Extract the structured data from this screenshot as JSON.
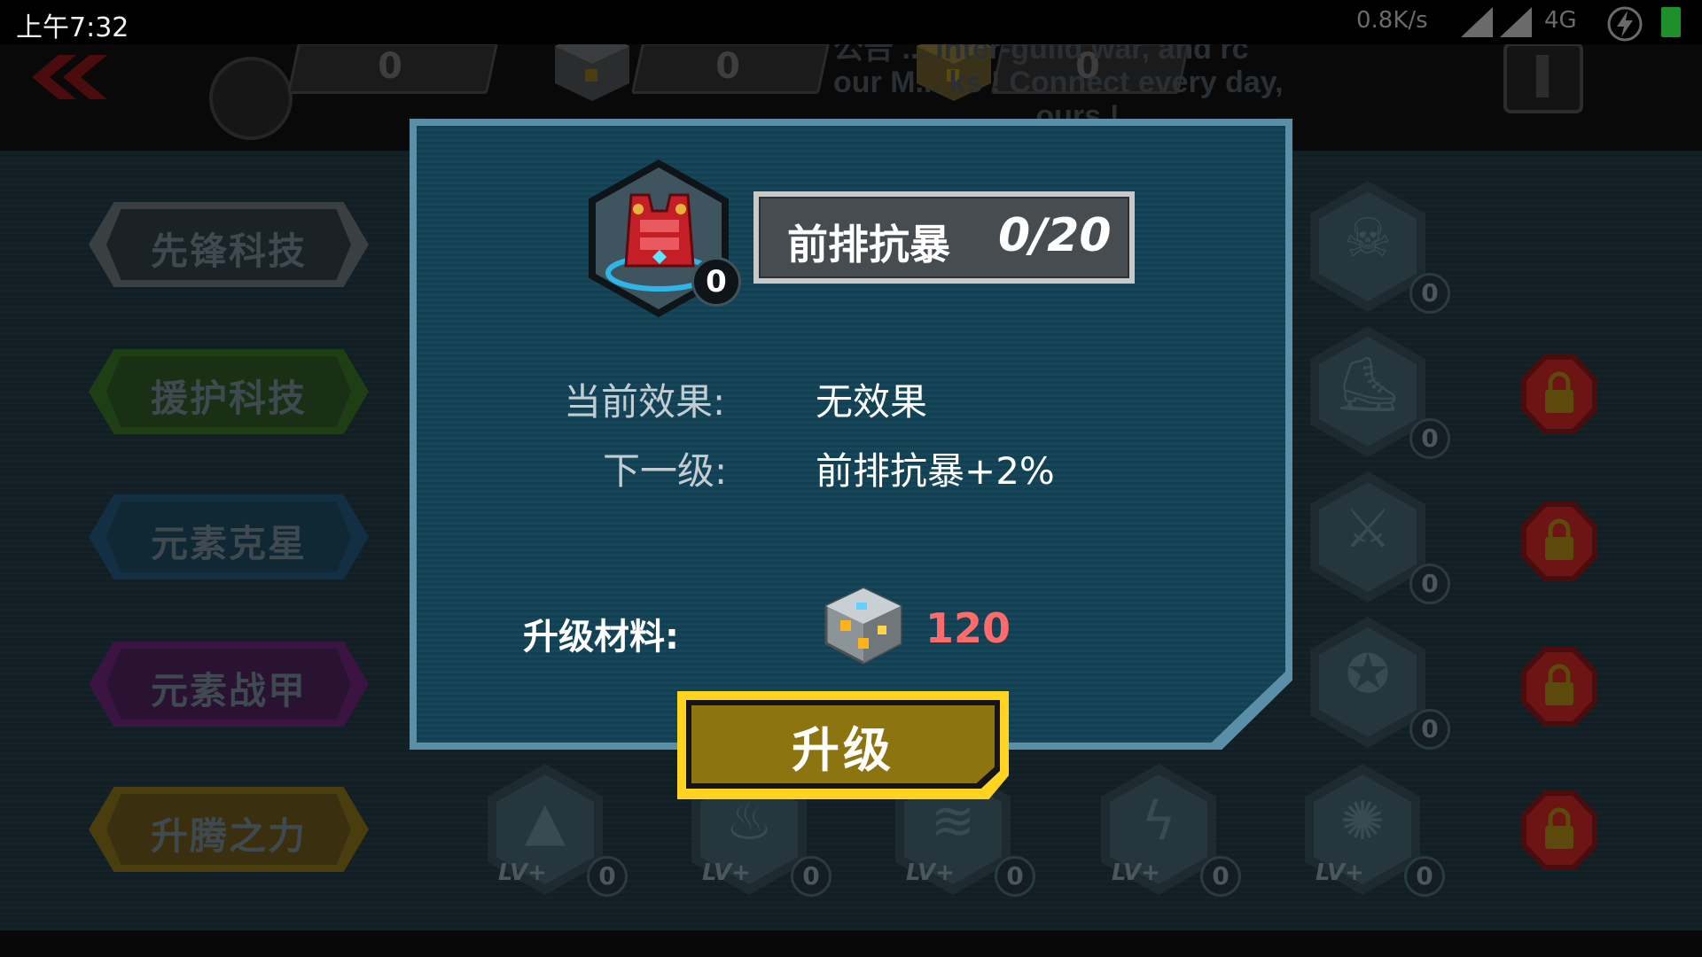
{
  "status_bar": {
    "time": "上午7:32",
    "net_speed": "0.8K/s",
    "network_type": "4G"
  },
  "resources": [
    {
      "icon": "medal-icon",
      "value": "0"
    },
    {
      "icon": "silver-cube-icon",
      "value": "0"
    },
    {
      "icon": "gold-cube-icon",
      "value": "0"
    }
  ],
  "ticker": {
    "line1": "公告 ... inter-guild war, and rc",
    "line2": "our M...     ks ! Connect every day,",
    "line3": "...ours !"
  },
  "categories": [
    {
      "label": "先锋科技",
      "color": "#6a6f72"
    },
    {
      "label": "援护科技",
      "color": "#2f7a1c"
    },
    {
      "label": "元素克星",
      "color": "#1d5f8c"
    },
    {
      "label": "元素战甲",
      "color": "#7a1d86"
    },
    {
      "label": "升腾之力",
      "color": "#a8861a"
    }
  ],
  "skill_slots_right": [
    {
      "icon": "skull-icon",
      "count": "0"
    },
    {
      "icon": "boot-icon",
      "count": "0"
    },
    {
      "icon": "blade-icon",
      "count": "0"
    },
    {
      "icon": "orbit-icon",
      "count": "0"
    }
  ],
  "bottom_slots": [
    {
      "icon": "mountain-icon",
      "lv": "LV+",
      "count": "0"
    },
    {
      "icon": "fire-icon",
      "lv": "LV+",
      "count": "0"
    },
    {
      "icon": "water-icon",
      "lv": "LV+",
      "count": "0"
    },
    {
      "icon": "lightning-icon",
      "lv": "LV+",
      "count": "0"
    },
    {
      "icon": "wind-icon",
      "lv": "LV+",
      "count": "0"
    }
  ],
  "modal": {
    "item_count": "0",
    "title_name": "前排抗暴",
    "title_level": "0/20",
    "current_effect_label": "当前效果:",
    "current_effect_value": "无效果",
    "next_level_label": "下一级:",
    "next_level_value": "前排抗暴+2%",
    "material_label": "升级材料:",
    "material_cost": "120",
    "upgrade_button": "升级"
  },
  "colors": {
    "accent_gold": "#ffd320",
    "cost_red": "#ff6b6b",
    "modal_blue": "#15475a"
  }
}
